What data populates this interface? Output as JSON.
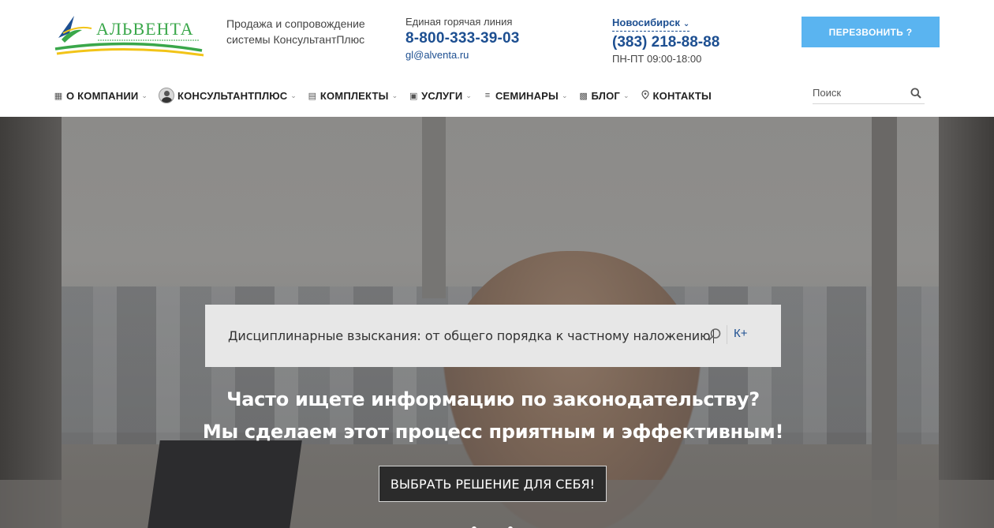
{
  "header": {
    "logo_text": "АЛЬВЕНТА",
    "tagline": "Продажа и сопровождение системы КонсультантПлюс",
    "hotline_label": "Единая горячая линия",
    "hotline_phone": "8-800-333-39-03",
    "email": "gl@alventa.ru",
    "city": "Новосибирск",
    "city_phone": "(383) 218-88-88",
    "hours": "ПН-ПТ 09:00-18:00",
    "callback_label": "ПЕРЕЗВОНИТЬ ?"
  },
  "nav": {
    "items": [
      {
        "label": "О КОМПАНИИ",
        "icon": "building-icon"
      },
      {
        "label": "КОНСУЛЬТАНТПЛЮС",
        "icon": "avatar-icon"
      },
      {
        "label": "КОМПЛЕКТЫ",
        "icon": "document-icon"
      },
      {
        "label": "УСЛУГИ",
        "icon": "truck-icon"
      },
      {
        "label": "СЕМИНАРЫ",
        "icon": "list-icon"
      },
      {
        "label": "БЛОГ",
        "icon": "book-icon"
      },
      {
        "label": "КОНТАКТЫ",
        "icon": "location-pin-icon"
      }
    ],
    "search_placeholder": "Поиск"
  },
  "hero": {
    "search_query": "Дисциплинарные взыскания: от общего порядка к частному наложению",
    "kplus_label": "К+",
    "headline_line1": "Часто ищете информацию по законодательству?",
    "headline_line2": "Мы сделаем этот процесс приятным и эффективным!",
    "cta_label": "ВЫБРАТЬ РЕШЕНИЕ ДЛЯ СЕБЯ!"
  },
  "colors": {
    "brand_blue": "#1d4f91",
    "callback_bg": "#5ab4f0",
    "logo_green": "#3aa74a",
    "logo_yellow": "#f2c418"
  }
}
